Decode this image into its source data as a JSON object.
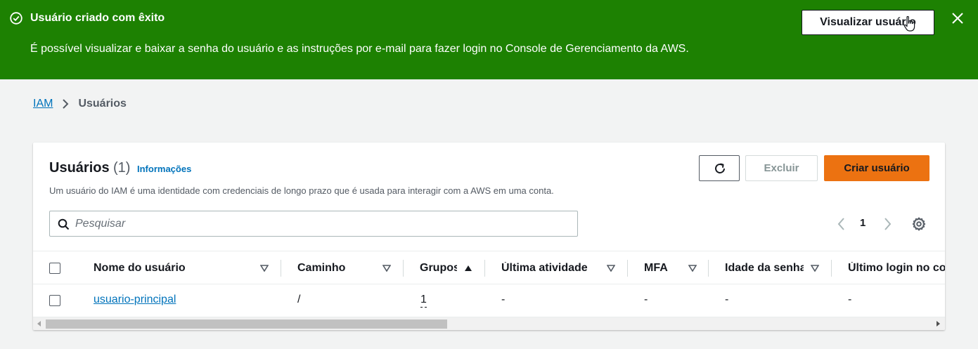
{
  "flash": {
    "title": "Usuário criado com êxito",
    "message": "É possível visualizar e baixar a senha do usuário e as instruções por e-mail para fazer login no Console de Gerenciamento da AWS.",
    "view_button": "Visualizar usuário",
    "color": "#1d8102"
  },
  "breadcrumb": {
    "root": "IAM",
    "current": "Usuários"
  },
  "users_panel": {
    "title": "Usuários",
    "count": "(1)",
    "info_link": "Informações",
    "description": "Um usuário do IAM é uma identidade com credenciais de longo prazo que é usada para interagir com a AWS em uma conta.",
    "delete_button": "Excluir",
    "create_button": "Criar usuário",
    "search_placeholder": "Pesquisar",
    "page_number": "1"
  },
  "table": {
    "columns": [
      "Nome do usuário",
      "Caminho",
      "Grupos",
      "Última atividade",
      "MFA",
      "Idade da senha",
      "Último login no console"
    ],
    "rows": [
      [
        "usuario-principal",
        "/",
        "1",
        "-",
        "-",
        "-",
        "-"
      ]
    ]
  },
  "colors": {
    "accent": "#ec7211",
    "link": "#0073bb"
  }
}
